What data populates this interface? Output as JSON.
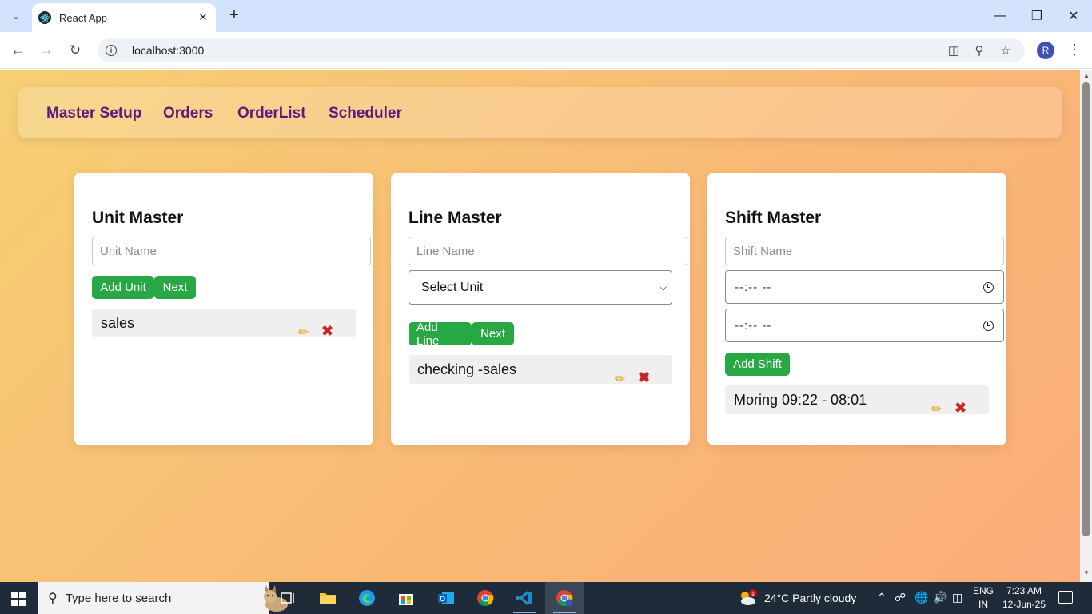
{
  "browser": {
    "tab_title": "React App",
    "url": "localhost:3000",
    "profile_initial": "R"
  },
  "nav": {
    "links": [
      "Master Setup",
      "Orders",
      "OrderList",
      "Scheduler"
    ]
  },
  "unit_master": {
    "title": "Unit Master",
    "input_placeholder": "Unit Name",
    "add_label": "Add Unit",
    "next_label": "Next",
    "items": [
      "sales"
    ]
  },
  "line_master": {
    "title": "Line Master",
    "input_placeholder": "Line Name",
    "select_value": "Select Unit",
    "add_label": "Add Line",
    "next_label": "Next",
    "items": [
      "checking -sales"
    ]
  },
  "shift_master": {
    "title": "Shift Master",
    "input_placeholder": "Shift Name",
    "start_time": "--:-- --",
    "end_time": "--:-- --",
    "add_label": "Add Shift",
    "items": [
      "Moring 09:22 - 08:01"
    ]
  },
  "taskbar": {
    "search_placeholder": "Type here to search",
    "weather": "24°C  Partly cloudy",
    "weather_badge": "1",
    "lang_1": "ENG",
    "lang_2": "IN",
    "time": "7:23 AM",
    "date": "12-Jun-25"
  },
  "colors": {
    "nav_link": "#5b1a7d",
    "button": "#28a745",
    "delete": "#c62828",
    "edit": "#e0a000"
  }
}
